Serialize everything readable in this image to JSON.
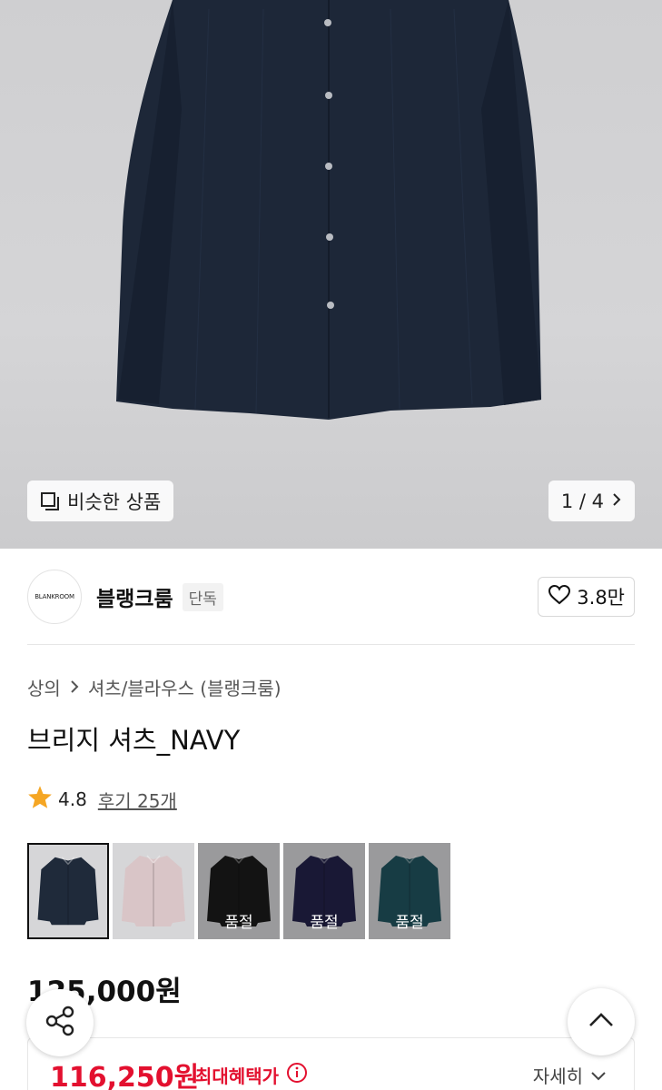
{
  "gallery": {
    "similar_label": "비슷한 상품",
    "pager": "1 / 4"
  },
  "brand": {
    "logo_text": "BLANKROOM",
    "name": "블랭크룸",
    "badge": "단독",
    "likes": "3.8만"
  },
  "breadcrumb": {
    "category": "상의",
    "subcategory": "셔츠/블라우스 (블랭크룸)"
  },
  "product": {
    "title": "브리지 셔츠_NAVY",
    "rating": "4.8",
    "reviews": "후기 25개"
  },
  "colors": [
    {
      "name": "navy",
      "color": "#1f2a3a",
      "selected": true,
      "sold_out": false
    },
    {
      "name": "pink",
      "color": "#d9c5c7",
      "selected": false,
      "sold_out": false
    },
    {
      "name": "black",
      "color": "#1b1b1b",
      "selected": false,
      "sold_out": true,
      "sold_out_label": "품절"
    },
    {
      "name": "purple-navy",
      "color": "#23224a",
      "selected": false,
      "sold_out": true,
      "sold_out_label": "품절"
    },
    {
      "name": "teal",
      "color": "#21545f",
      "selected": false,
      "sold_out": true,
      "sold_out_label": "품절"
    }
  ],
  "price": {
    "original": "125,000원",
    "benefit_price": "116,250원",
    "benefit_label": "최대혜택가",
    "detail_label": "자세히"
  },
  "theme": {
    "accent": "#e3102f",
    "star": "#f5a623"
  }
}
